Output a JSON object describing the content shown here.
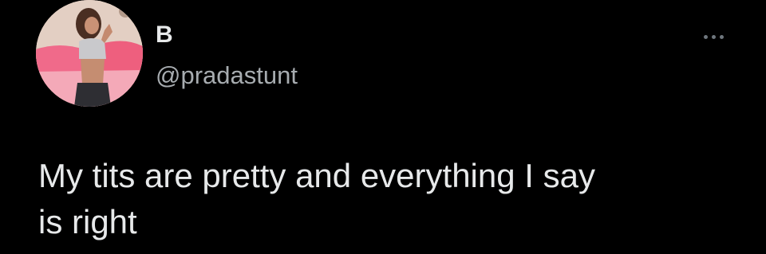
{
  "author": {
    "display_name": "B",
    "handle": "@pradastunt",
    "avatar_icon": "profile-photo"
  },
  "actions": {
    "more_icon": "more-horizontal-icon"
  },
  "tweet": {
    "text": "My tits are pretty and everything I say\nis right"
  },
  "colors": {
    "background": "#000000",
    "primary_text": "#e7e9ea",
    "secondary_text": "#a7acb0",
    "icon_muted": "#6e767d"
  }
}
